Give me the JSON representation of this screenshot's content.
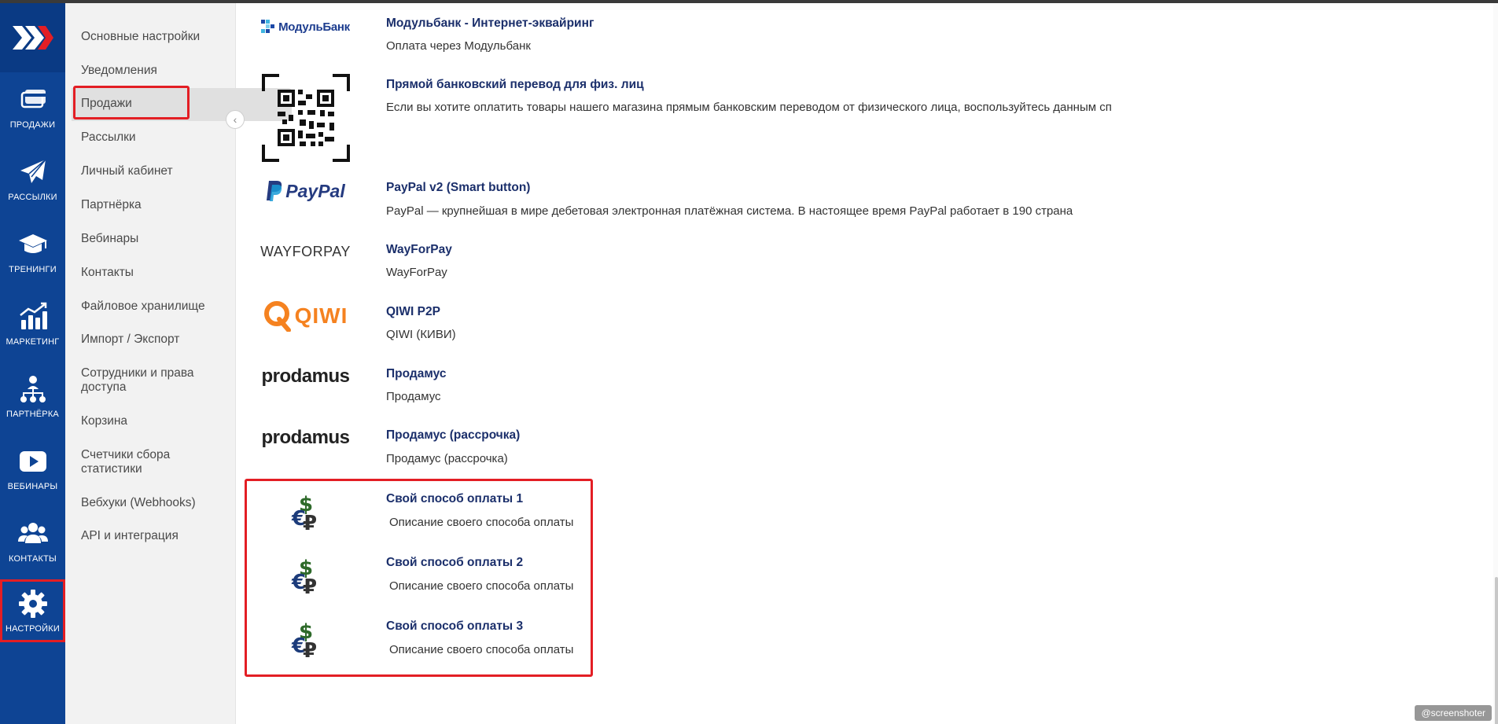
{
  "rail": {
    "items": [
      {
        "label": "ПРОДАЖИ",
        "icon": "card-icon"
      },
      {
        "label": "РАССЫЛКИ",
        "icon": "paper-plane-icon"
      },
      {
        "label": "ТРЕНИНГИ",
        "icon": "graduation-cap-icon"
      },
      {
        "label": "МАРКЕТИНГ",
        "icon": "chart-growth-icon"
      },
      {
        "label": "ПАРТНЁРКА",
        "icon": "network-icon"
      },
      {
        "label": "ВЕБИНАРЫ",
        "icon": "play-icon"
      },
      {
        "label": "КОНТАКТЫ",
        "icon": "users-icon"
      },
      {
        "label": "НАСТРОЙКИ",
        "icon": "gear-icon"
      }
    ]
  },
  "menu": {
    "items": [
      "Основные настройки",
      "Уведомления",
      "Продажи",
      "Рассылки",
      "Личный кабинет",
      "Партнёрка",
      "Вебинары",
      "Контакты",
      "Файловое хранилище",
      "Импорт / Экспорт",
      "Сотрудники и права доступа",
      "Корзина",
      "Счетчики сбора статистики",
      "Вебхуки (Webhooks)",
      "API и интеграция"
    ],
    "active": "Продажи"
  },
  "payment_methods": [
    {
      "logo": "МодульБанк",
      "title": "Модульбанк - Интернет-эквайринг",
      "desc": "Оплата через Модульбанк"
    },
    {
      "logo": "qr-code",
      "title": "Прямой банковский перевод для физ. лиц",
      "desc": "Если вы хотите оплатить товары нашего магазина прямым банковским переводом от физического лица, воспользуйтесь данным сп"
    },
    {
      "logo": "PayPal",
      "title": "PayPal v2 (Smart button)",
      "desc": "PayPal — крупнейшая в мире дебетовая электронная платёжная система. В настоящее время PayPal работает в 190 страна"
    },
    {
      "logo": "WAYFORPAY",
      "title": "WayForPay",
      "desc": "WayForPay"
    },
    {
      "logo": "QIWI",
      "title": "QIWI P2P",
      "desc": "QIWI (КИВИ)"
    },
    {
      "logo": "prodamus",
      "title": "Продамус",
      "desc": "Продамус"
    },
    {
      "logo": "prodamus",
      "title": "Продамус (рассрочка)",
      "desc": "Продамус (рассрочка)"
    },
    {
      "logo": "currency",
      "title": "Свой способ оплаты 1",
      "desc": "Описание своего способа оплаты"
    },
    {
      "logo": "currency",
      "title": "Свой способ оплаты 2",
      "desc": "Описание своего способа оплаты"
    },
    {
      "logo": "currency",
      "title": "Свой способ оплаты 3",
      "desc": "Описание своего способа оплаты"
    }
  ],
  "watermark": "@screenshoter",
  "colors": {
    "rail": "#0e4494",
    "accent_red": "#e31e24",
    "title_blue": "#1b2f6b"
  }
}
